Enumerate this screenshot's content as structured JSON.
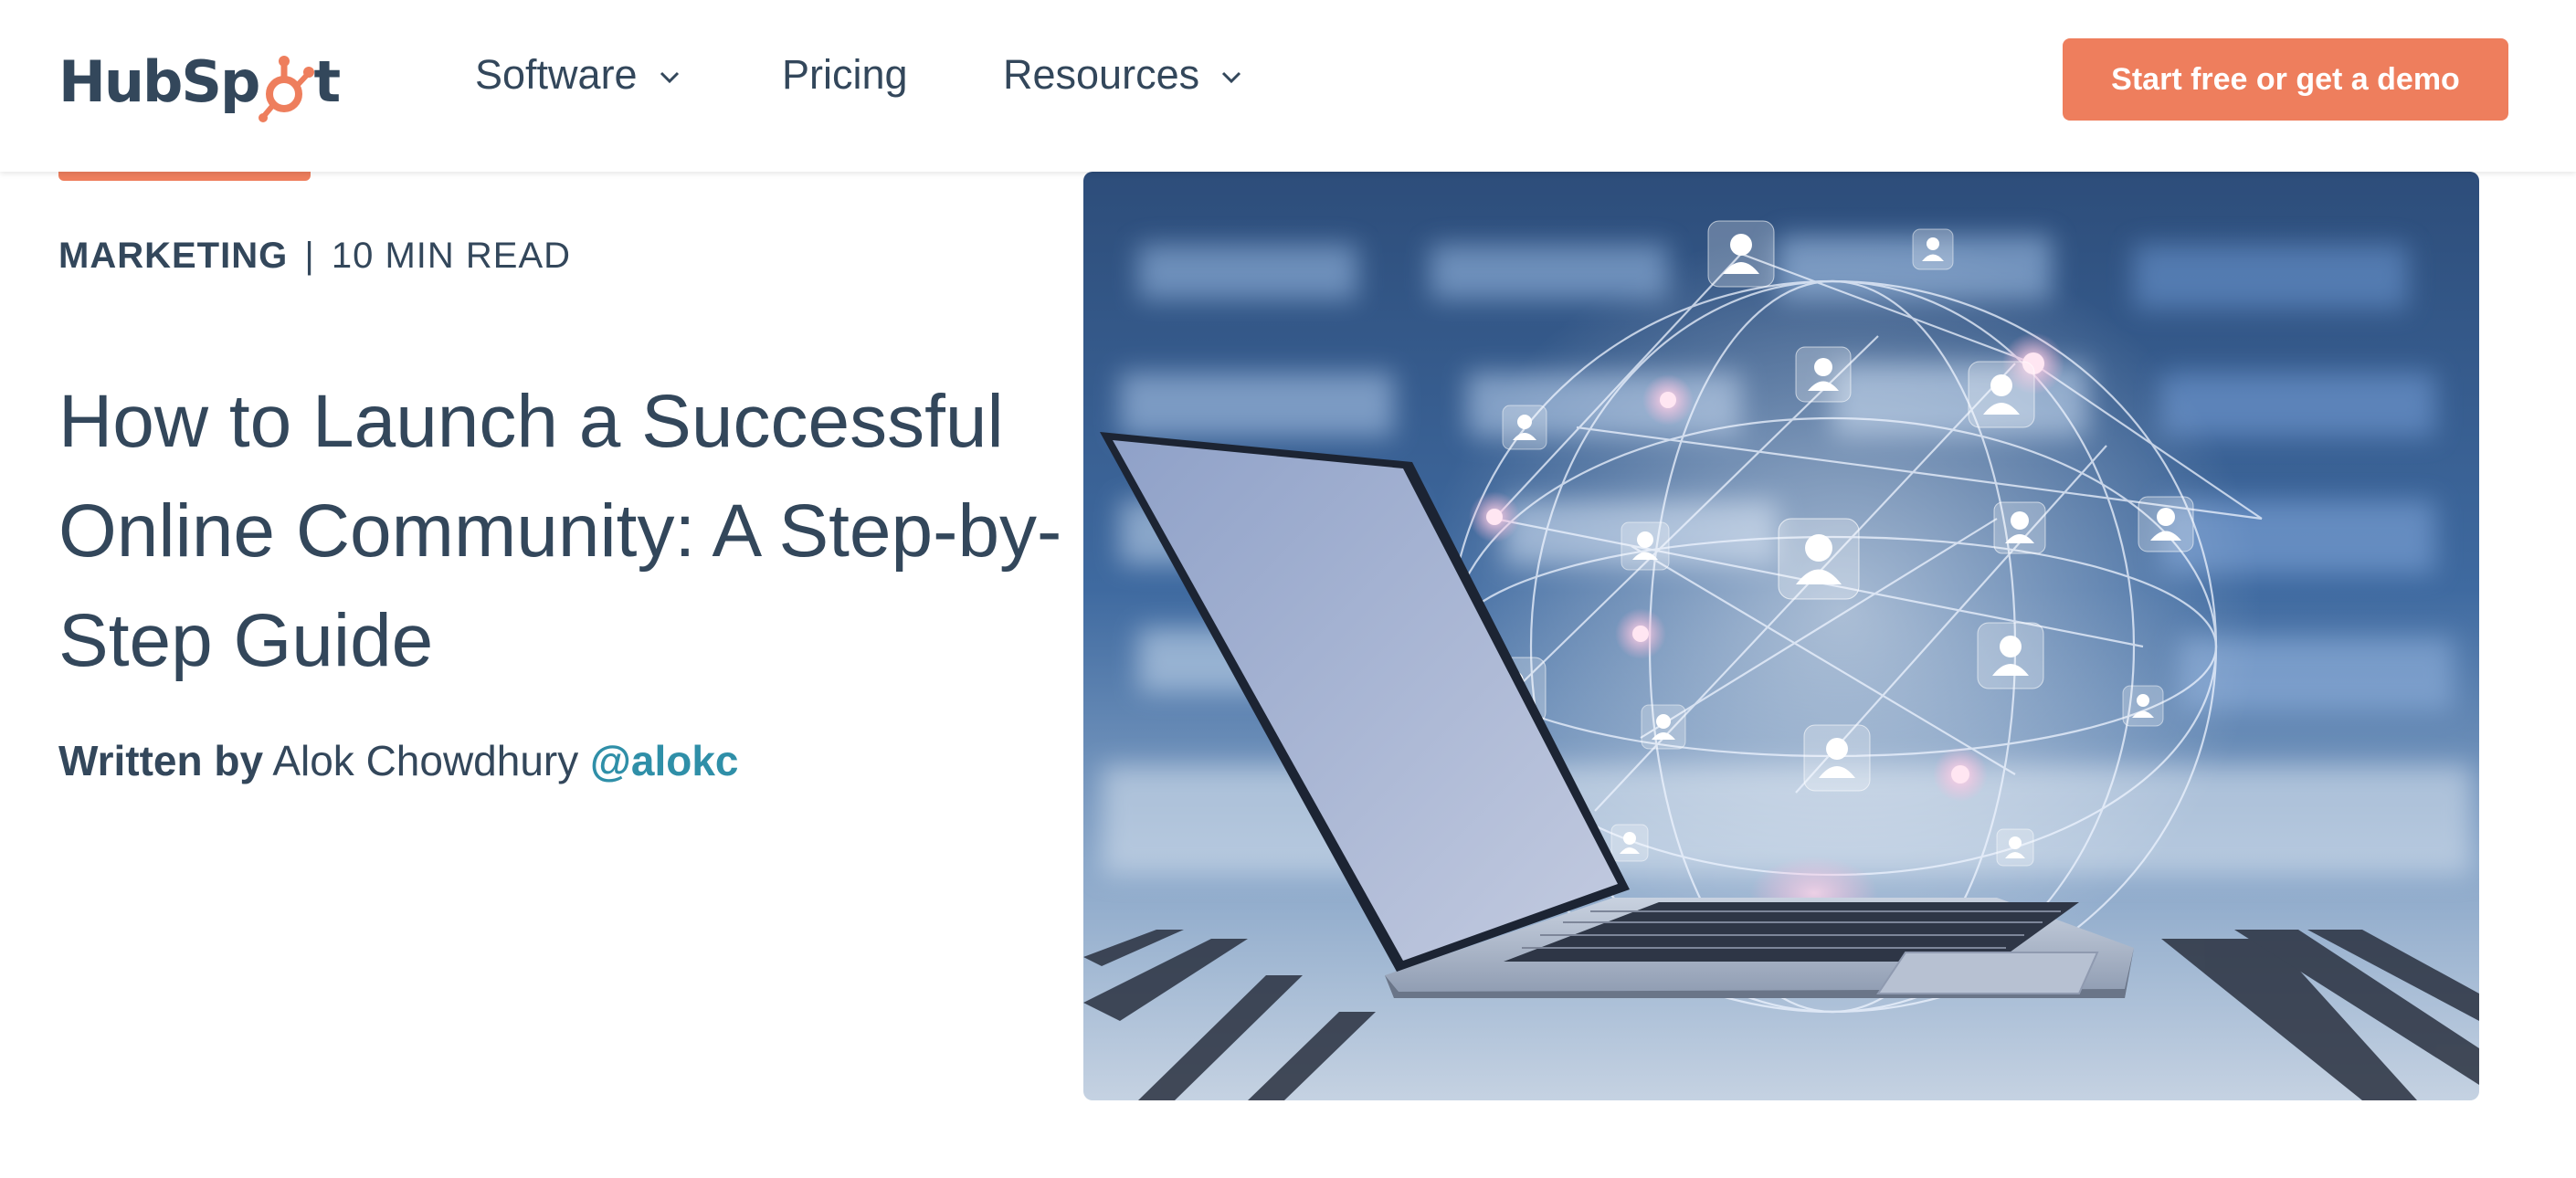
{
  "brand": {
    "logo_text_left": "HubSp",
    "logo_text_right": "t",
    "accent_color": "#ee7e5d"
  },
  "nav": {
    "items": [
      {
        "label": "Software",
        "has_dropdown": true
      },
      {
        "label": "Pricing",
        "has_dropdown": false
      },
      {
        "label": "Resources",
        "has_dropdown": true
      }
    ],
    "cta_label": "Start free or get a demo"
  },
  "article": {
    "category": "MARKETING",
    "separator": "|",
    "read_time": "10 MIN READ",
    "title": "How to Launch a Successful Online Community: A Step-by-Step Guide",
    "byline_prefix": "Written by",
    "author": "Alok Chowdhury",
    "author_handle": "@alokc"
  },
  "hero": {
    "icon": "laptop-network-illustration"
  }
}
